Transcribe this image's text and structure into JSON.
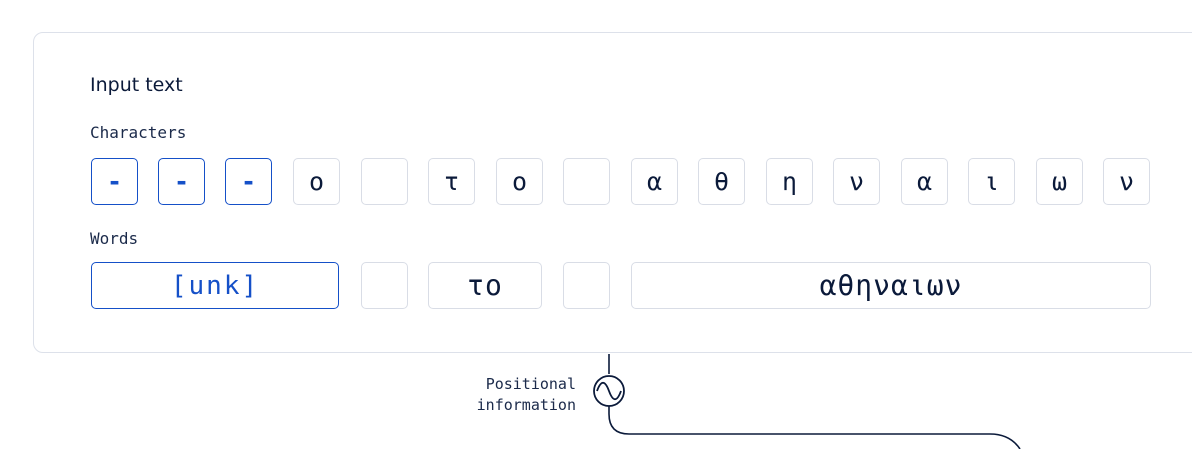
{
  "input_text_title": "Input text",
  "characters": {
    "label": "Characters",
    "tokens": [
      {
        "text": "-",
        "highlighted": true
      },
      {
        "text": "-",
        "highlighted": true
      },
      {
        "text": "-",
        "highlighted": true
      },
      {
        "text": "ο",
        "highlighted": false
      },
      {
        "text": "",
        "highlighted": false
      },
      {
        "text": "τ",
        "highlighted": false
      },
      {
        "text": "ο",
        "highlighted": false
      },
      {
        "text": "",
        "highlighted": false
      },
      {
        "text": "α",
        "highlighted": false
      },
      {
        "text": "θ",
        "highlighted": false
      },
      {
        "text": "η",
        "highlighted": false
      },
      {
        "text": "ν",
        "highlighted": false
      },
      {
        "text": "α",
        "highlighted": false
      },
      {
        "text": "ι",
        "highlighted": false
      },
      {
        "text": "ω",
        "highlighted": false
      },
      {
        "text": "ν",
        "highlighted": false
      }
    ]
  },
  "words": {
    "label": "Words",
    "tokens": [
      {
        "text": "[unk]",
        "highlighted": true
      },
      {
        "text": "",
        "highlighted": false
      },
      {
        "text": "το",
        "highlighted": false
      },
      {
        "text": "",
        "highlighted": false
      },
      {
        "text": "αθηναιων",
        "highlighted": false
      }
    ]
  },
  "positional": {
    "line1": "Positional",
    "line2": "information",
    "icon": "sine-wave-circle-icon"
  },
  "colors": {
    "highlight": "#1550c8",
    "border": "#d9dde6",
    "text": "#0b1a3a"
  }
}
